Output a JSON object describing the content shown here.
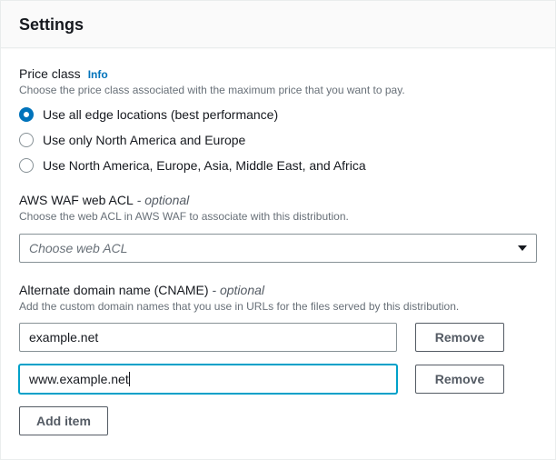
{
  "header": {
    "title": "Settings"
  },
  "price_class": {
    "label": "Price class",
    "info": "Info",
    "desc": "Choose the price class associated with the maximum price that you want to pay.",
    "selected_index": 0,
    "options": [
      "Use all edge locations (best performance)",
      "Use only North America and Europe",
      "Use North America, Europe, Asia, Middle East, and Africa"
    ]
  },
  "waf": {
    "label_main": "AWS WAF web ACL",
    "label_optional": " - optional",
    "desc": "Choose the web ACL in AWS WAF to associate with this distribution.",
    "placeholder": "Choose web ACL"
  },
  "cname": {
    "label_main": "Alternate domain name (CNAME)",
    "label_optional": " - optional",
    "desc": "Add the custom domain names that you use in URLs for the files served by this distribution.",
    "items": [
      {
        "value": "example.net",
        "focused": false
      },
      {
        "value": "www.example.net",
        "focused": true
      }
    ],
    "remove_label": "Remove",
    "add_label": "Add item"
  }
}
